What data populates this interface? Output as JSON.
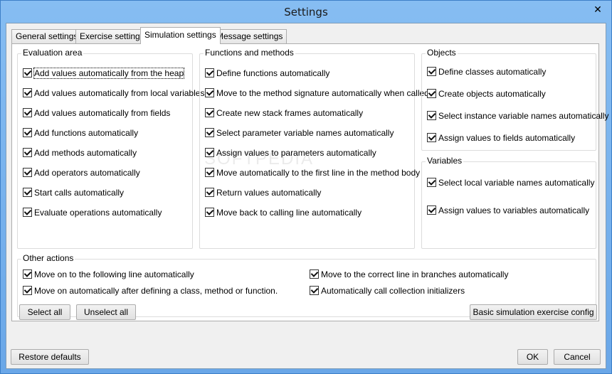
{
  "window": {
    "title": "Settings",
    "close_glyph": "✕"
  },
  "tabs": [
    {
      "label": "General settings"
    },
    {
      "label": "Exercise settings"
    },
    {
      "label": "Simulation settings"
    },
    {
      "label": "Message settings"
    }
  ],
  "active_tab": "Simulation settings",
  "watermark": "SOFTPEDIA",
  "groups": {
    "evaluation": {
      "title": "Evaluation area",
      "items": [
        {
          "label": "Add values automatically from the heap",
          "checked": true
        },
        {
          "label": "Add values automatically from local variables",
          "checked": true
        },
        {
          "label": "Add values automatically from fields",
          "checked": true
        },
        {
          "label": "Add functions automatically",
          "checked": true
        },
        {
          "label": "Add methods automatically",
          "checked": true
        },
        {
          "label": "Add operators automatically",
          "checked": true
        },
        {
          "label": "Start calls automatically",
          "checked": true
        },
        {
          "label": "Evaluate operations automatically",
          "checked": true
        }
      ]
    },
    "functions": {
      "title": "Functions and methods",
      "items": [
        {
          "label": "Define functions automatically",
          "checked": true
        },
        {
          "label": "Move to the method signature automatically when called",
          "checked": true
        },
        {
          "label": "Create new stack frames automatically",
          "checked": true
        },
        {
          "label": "Select parameter variable names automatically",
          "checked": true
        },
        {
          "label": "Assign values to parameters automatically",
          "checked": true
        },
        {
          "label": "Move automatically to the first line in the method body",
          "checked": true
        },
        {
          "label": "Return values automatically",
          "checked": true
        },
        {
          "label": "Move back to calling line automatically",
          "checked": true
        }
      ]
    },
    "objects": {
      "title": "Objects",
      "items": [
        {
          "label": "Define classes automatically",
          "checked": true
        },
        {
          "label": "Create objects automatically",
          "checked": true
        },
        {
          "label": "Select instance variable names automatically",
          "checked": true
        },
        {
          "label": "Assign values to fields automatically",
          "checked": true
        }
      ]
    },
    "variables": {
      "title": "Variables",
      "items": [
        {
          "label": "Select local variable names automatically",
          "checked": true
        },
        {
          "label": "Assign values to variables automatically",
          "checked": true
        }
      ]
    },
    "other": {
      "title": "Other actions",
      "items": [
        {
          "label": "Move on to the following line automatically",
          "checked": true
        },
        {
          "label": "Move on automatically after defining a class, method or function.",
          "checked": true
        },
        {
          "label": "Move to the correct line in branches automatically",
          "checked": true
        },
        {
          "label": "Automatically call collection initializers",
          "checked": true
        }
      ]
    }
  },
  "buttons": {
    "select_all": "Select all",
    "unselect_all": "Unselect all",
    "basic_config": "Basic simulation exercise config",
    "restore_defaults": "Restore defaults",
    "ok": "OK",
    "cancel": "Cancel"
  }
}
